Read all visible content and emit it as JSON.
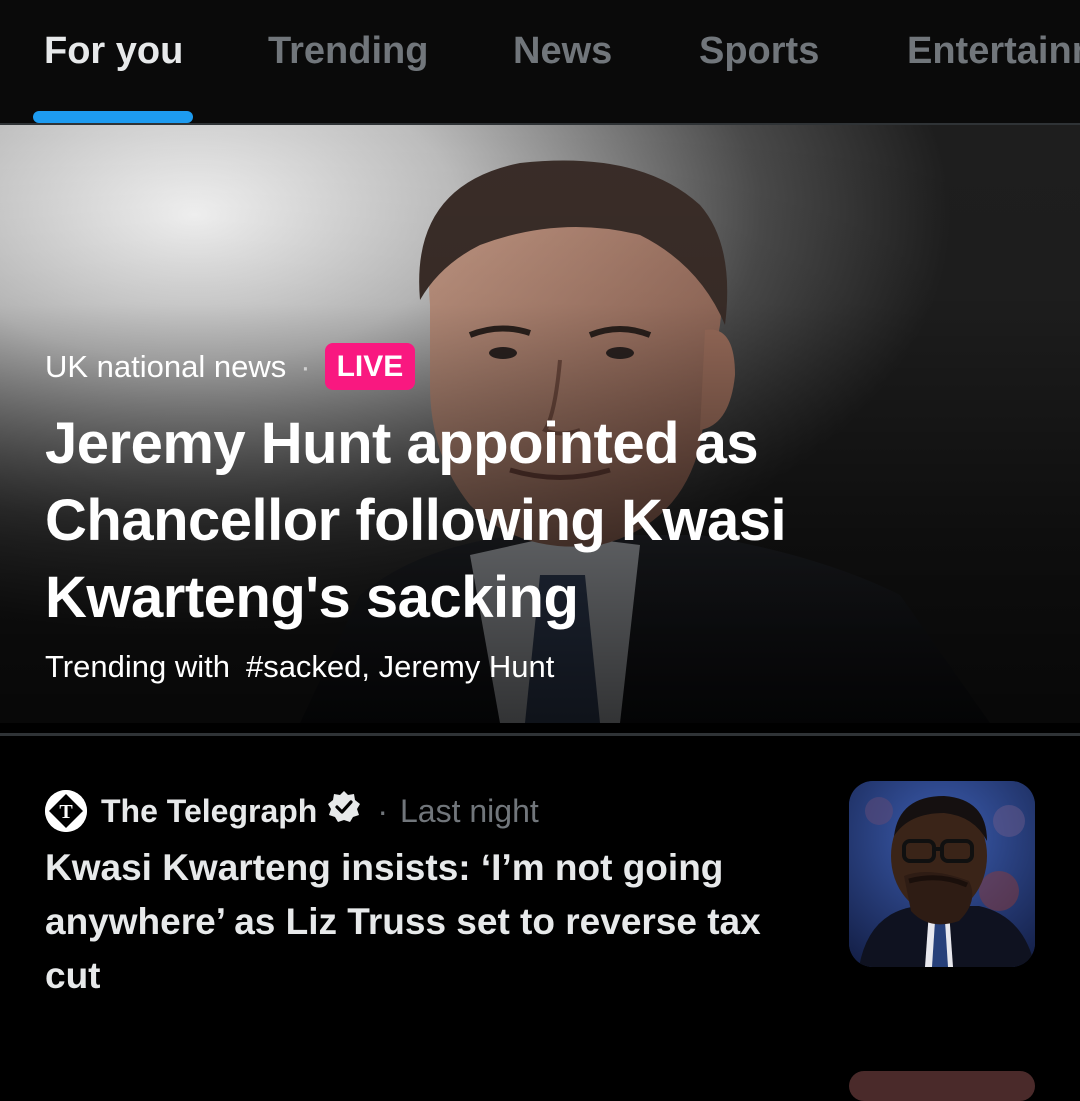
{
  "tabs": [
    {
      "label": "For you",
      "active": true
    },
    {
      "label": "Trending",
      "active": false
    },
    {
      "label": "News",
      "active": false
    },
    {
      "label": "Sports",
      "active": false
    },
    {
      "label": "Entertainment",
      "active": false
    }
  ],
  "accent_color": "#1d9bf0",
  "live_color": "#f91880",
  "hero": {
    "category": "UK national news",
    "separator": "·",
    "live_label": "LIVE",
    "title": "Jeremy Hunt appointed as Chancellor following Kwasi Kwarteng's sacking",
    "trending_prefix": "Trending with",
    "trending_tags": "#sacked, Jeremy Hunt"
  },
  "story": {
    "source": "The Telegraph",
    "verified": true,
    "separator": "·",
    "time": "Last night",
    "title": "Kwasi Kwarteng insists: ‘I’m not going anywhere’ as Liz Truss set to reverse tax cut"
  }
}
